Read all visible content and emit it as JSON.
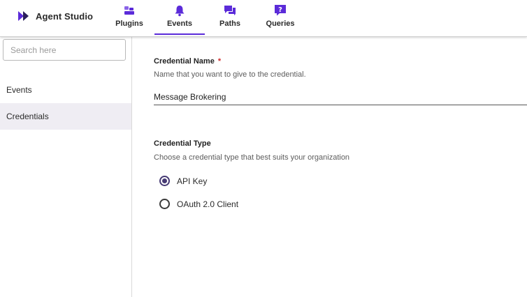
{
  "app": {
    "title": "Agent Studio",
    "logo_icon": "double-chevron-play-icon",
    "accent_color": "#5b2bd9"
  },
  "nav": {
    "tabs": [
      {
        "label": "Plugins",
        "icon": "plugin-blocks-icon",
        "active": false
      },
      {
        "label": "Events",
        "icon": "bell-icon",
        "active": true
      },
      {
        "label": "Paths",
        "icon": "chat-bubbles-icon",
        "active": false
      },
      {
        "label": "Queries",
        "icon": "question-bubble-icon",
        "active": false
      }
    ]
  },
  "sidebar": {
    "search_placeholder": "Search here",
    "items": [
      {
        "label": "Events",
        "selected": false
      },
      {
        "label": "Credentials",
        "selected": true
      }
    ]
  },
  "form": {
    "credential_name": {
      "label": "Credential Name",
      "required_marker": "*",
      "help": "Name that you want to give to the credential.",
      "value": "Message Brokering"
    },
    "credential_type": {
      "label": "Credential Type",
      "help": "Choose a credential type that best suits your organization",
      "options": [
        {
          "label": "API Key",
          "checked": true
        },
        {
          "label": "OAuth 2.0 Client",
          "checked": false
        }
      ]
    }
  }
}
